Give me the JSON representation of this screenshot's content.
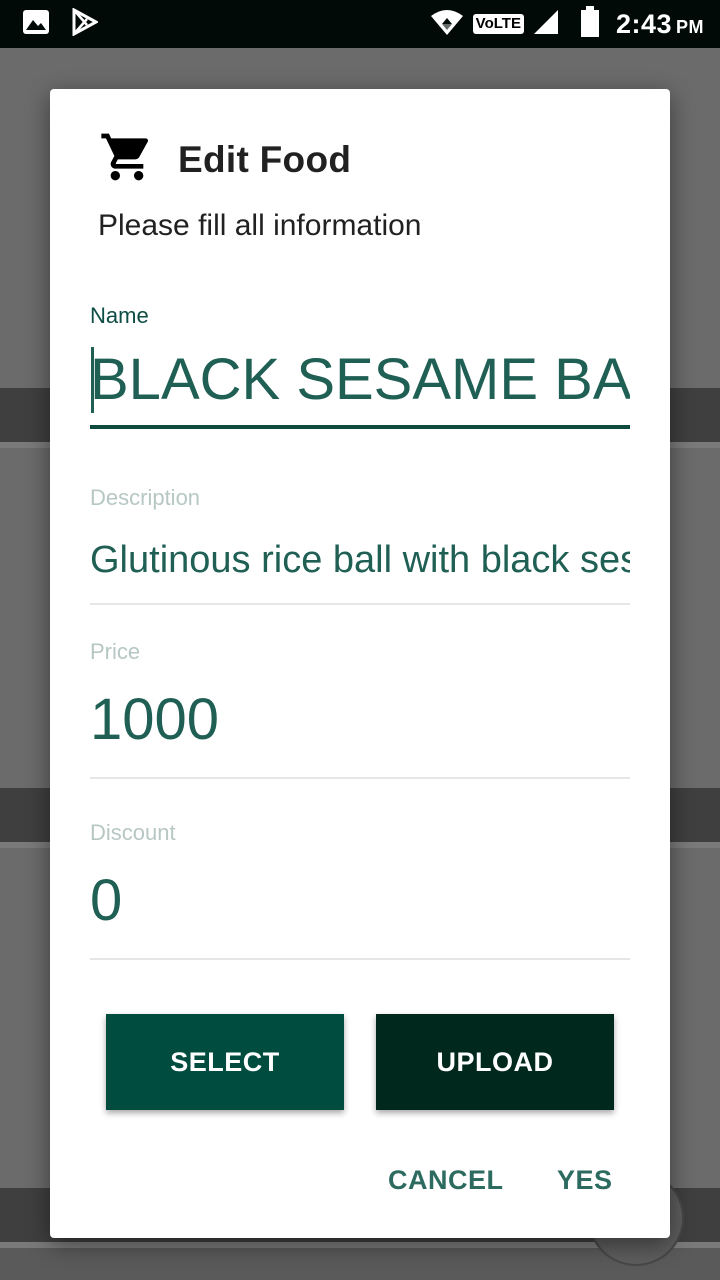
{
  "status_bar": {
    "time": "2:43",
    "ampm": "PM",
    "network_label": "VoLTE",
    "icons": [
      "gallery-icon",
      "play-store-icon",
      "wifi-icon",
      "signal-icon",
      "battery-icon"
    ]
  },
  "dialog": {
    "icon": "cart-icon",
    "title": "Edit Food",
    "message": "Please fill all information",
    "fields": {
      "name": {
        "label": "Name",
        "value": "BLACK SESAME BALL"
      },
      "description": {
        "label": "Description",
        "value": "Glutinous rice ball with black sesame"
      },
      "price": {
        "label": "Price",
        "value": "1000"
      },
      "discount": {
        "label": "Discount",
        "value": "0"
      }
    },
    "buttons": {
      "select": "SELECT",
      "upload": "UPLOAD",
      "cancel": "CANCEL",
      "yes": "YES"
    }
  },
  "colors": {
    "accent": "#004d40",
    "upload_button": "#00281d",
    "text_accent": "#2d6b60",
    "status_bar": "#020a07"
  }
}
